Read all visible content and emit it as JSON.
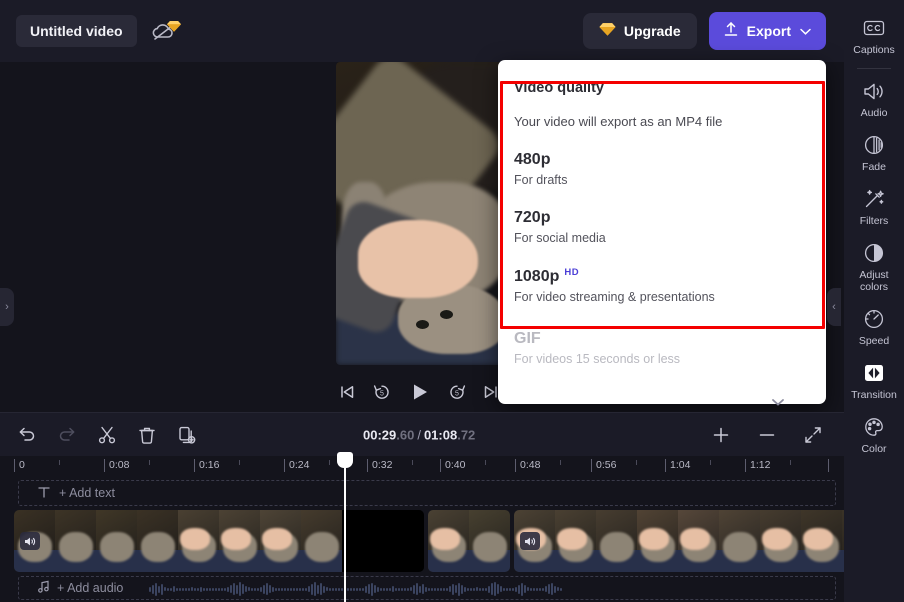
{
  "topbar": {
    "project_title": "Untitled video",
    "cloud_status_icon": "cloud-off-icon",
    "premium_badge_icon": "gem-icon",
    "upgrade_label": "Upgrade",
    "export_label": "Export"
  },
  "preview": {
    "controls": [
      {
        "name": "skip-to-start-button",
        "icon": "skip-start-icon"
      },
      {
        "name": "rewind-5s-button",
        "icon": "rewind-5-icon",
        "label": "5"
      },
      {
        "name": "play-button",
        "icon": "play-icon"
      },
      {
        "name": "forward-5s-button",
        "icon": "forward-5-icon",
        "label": "5"
      },
      {
        "name": "skip-to-end-button",
        "icon": "skip-end-icon"
      }
    ]
  },
  "export_dropdown": {
    "title": "Video quality",
    "subtitle": "Your video will export as an MP4 file",
    "highlight_color": "#f40000",
    "hd_badge": "HD",
    "hd_badge_color": "#4b3fd6",
    "options": [
      {
        "name": "480p",
        "description": "For drafts",
        "badge": "",
        "disabled": false
      },
      {
        "name": "720p",
        "description": "For social media",
        "badge": "",
        "disabled": false
      },
      {
        "name": "1080p",
        "description": "For video streaming & presentations",
        "badge": "HD",
        "disabled": false
      },
      {
        "name": "GIF",
        "description": "For videos 15 seconds or less",
        "badge": "",
        "disabled": true
      }
    ]
  },
  "timeline": {
    "tools": [
      {
        "name": "undo-button",
        "icon": "undo-icon",
        "dim": false
      },
      {
        "name": "redo-button",
        "icon": "redo-icon",
        "dim": true
      },
      {
        "name": "split-button",
        "icon": "scissors-icon",
        "dim": false
      },
      {
        "name": "delete-button",
        "icon": "trash-icon",
        "dim": false
      },
      {
        "name": "duplicate-button",
        "icon": "duplicate-icon",
        "dim": false
      }
    ],
    "current_time": "00:29",
    "current_time_frac": ".60",
    "total_time": "01:08",
    "total_time_frac": ".72",
    "time_separator": "/",
    "zoom_in_label": "+",
    "zoom_out_label": "−",
    "fit_icon": "fit-screen-icon",
    "ruler_labels": [
      "0",
      "0:08",
      "0:16",
      "0:24",
      "0:32",
      "0:40",
      "0:48",
      "0:56",
      "1:04",
      "1:12"
    ],
    "add_text_label": "+ Add text",
    "add_text_icon": "text-icon",
    "add_audio_label": "+ Add audio",
    "add_audio_icon": "music-note-icon",
    "clip_audio_icon": "speaker-icon",
    "playhead_position_label": "00:29.60"
  },
  "sidebar": {
    "items": [
      {
        "label": "Captions",
        "icon": "closed-caption-icon",
        "active": false
      },
      {
        "label": "Audio",
        "icon": "speaker-icon",
        "active": false
      },
      {
        "label": "Fade",
        "icon": "fade-icon",
        "active": false
      },
      {
        "label": "Filters",
        "icon": "magic-wand-icon",
        "active": false
      },
      {
        "label": "Adjust colors",
        "icon": "contrast-icon",
        "active": false
      },
      {
        "label": "Speed",
        "icon": "speedometer-icon",
        "active": false
      },
      {
        "label": "Transition",
        "icon": "transition-icon",
        "active": true
      },
      {
        "label": "Color",
        "icon": "palette-icon",
        "active": false
      }
    ]
  },
  "panel_handles": {
    "left_chevron": "›",
    "right_chevron": "‹",
    "dropdown_scroll_chevron": "∨"
  }
}
